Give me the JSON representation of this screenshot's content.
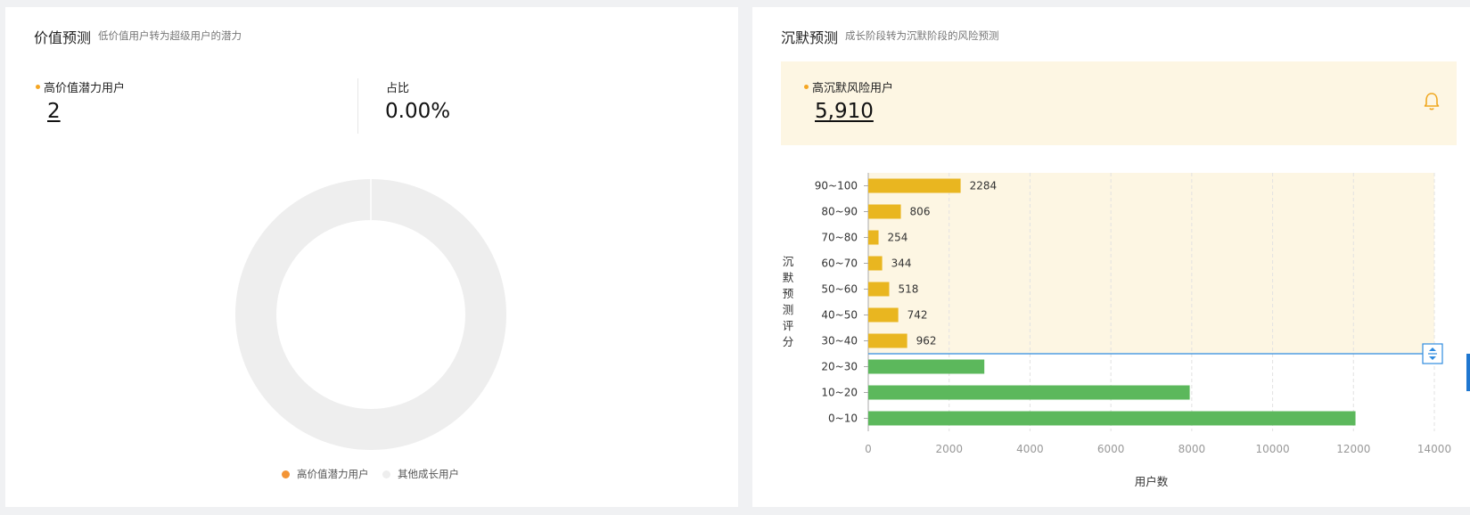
{
  "left": {
    "title": "价值预测",
    "subtitle": "低价值用户转为超级用户的潜力",
    "kpi1": {
      "label": "高价值潜力用户",
      "value": "2",
      "dot_color": "#f5a623"
    },
    "kpi2": {
      "label": "占比",
      "value": "0.00%"
    },
    "legend": [
      {
        "label": "高价值潜力用户",
        "color": "#f39436"
      },
      {
        "label": "其他成长用户",
        "color": "#eeeeee"
      }
    ]
  },
  "right": {
    "title": "沉默预测",
    "subtitle": "成长阶段转为沉默阶段的风险预测",
    "kpi": {
      "label": "高沉默风险用户",
      "value": "5,910",
      "dot_color": "#f5a623"
    },
    "bell_icon": "bell-icon"
  },
  "chart_data": [
    {
      "type": "pie",
      "variant": "donut",
      "categories": [
        "高价值潜力用户",
        "其他成长用户"
      ],
      "values": [
        2,
        21960
      ],
      "colors": [
        "#f39436",
        "#eeeeee"
      ],
      "legend_position": "bottom"
    },
    {
      "type": "bar",
      "orientation": "horizontal",
      "categories": [
        "90~100",
        "80~90",
        "70~80",
        "60~70",
        "50~60",
        "40~50",
        "30~40",
        "20~30",
        "10~20",
        "0~10"
      ],
      "values": [
        2284,
        806,
        254,
        344,
        518,
        742,
        962,
        2870,
        7950,
        12050
      ],
      "data_labels": [
        "2284",
        "806",
        "254",
        "344",
        "518",
        "742",
        "962",
        "",
        "",
        ""
      ],
      "bar_colors": [
        "#e9b620",
        "#e9b620",
        "#e9b620",
        "#e9b620",
        "#e9b620",
        "#e9b620",
        "#e9b620",
        "#5cb85c",
        "#5cb85c",
        "#5cb85c"
      ],
      "highlight_band_color": "#fdf6e3",
      "threshold_line_color": "#2f8be0",
      "xlabel": "用户数",
      "ylabel": "沉默预测评分",
      "xlim": [
        0,
        14000
      ],
      "xticks": [
        "0",
        "2000",
        "4000",
        "6000",
        "8000",
        "10000",
        "12000",
        "14000"
      ],
      "grid": "vertical-dashed"
    }
  ]
}
